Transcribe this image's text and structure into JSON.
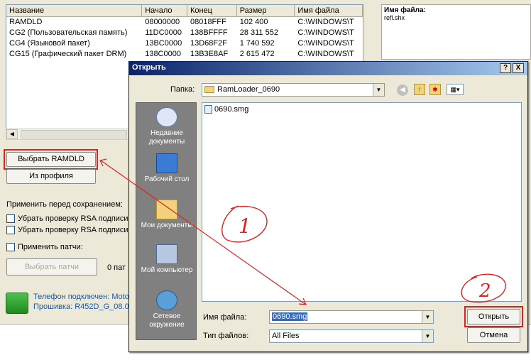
{
  "table": {
    "headers": [
      "Название",
      "Начало",
      "Конец",
      "Размер",
      "Имя файла"
    ],
    "rows": [
      [
        "RAMDLD",
        "08000000",
        "08018FFF",
        "102 400",
        "C:\\WINDOWS\\T"
      ],
      [
        "CG2 (Пользовательская память)",
        "11DC0000",
        "138BFFFF",
        "28 311 552",
        "C:\\WINDOWS\\T"
      ],
      [
        "CG4 (Языковой пакет)",
        "13BC0000",
        "13D68F2F",
        "1 740 592",
        "C:\\WINDOWS\\T"
      ],
      [
        "CG15 (Графический пакет DRM)",
        "138C0000",
        "13B3E8AF",
        "2 615 472",
        "C:\\WINDOWS\\T"
      ]
    ]
  },
  "info": {
    "label": "Имя файла:",
    "value": "refl.shx"
  },
  "buttons": {
    "select_ramdld": "Выбрать RAMDLD",
    "from_profile": "Из профиля",
    "select_patches": "Выбрать патчи"
  },
  "options": {
    "apply_before_save": "Применить перед сохранением:",
    "rsa1": "Убрать проверку RSA подписи",
    "rsa2": "Убрать проверку RSA подписи",
    "apply_patches": "Применить патчи:",
    "patch_count": "0 пат"
  },
  "status": {
    "line1": "Телефон подключен: Moto",
    "line2": "Прошивка: R452D_G_08.0"
  },
  "dialog": {
    "title": "Открыть",
    "folder_label": "Папка:",
    "folder_value": "RamLoader_0690",
    "places": [
      "Недавние документы",
      "Рабочий стол",
      "Мои документы",
      "Мой компьютер",
      "Сетевое окружение"
    ],
    "files": [
      "0690.smg"
    ],
    "filename_label": "Имя файла:",
    "filename_value": "0690.smg",
    "filetype_label": "Тип файлов:",
    "filetype_value": "All Files",
    "open_button": "Открыть",
    "cancel_button": "Отмена",
    "help_button": "?",
    "close_button": "X"
  },
  "annotations": {
    "step1": "1",
    "step2": "2"
  },
  "colors": {
    "annotation_red": "#e02020",
    "titlebar_start": "#0a246a",
    "titlebar_end": "#a6caf0"
  }
}
